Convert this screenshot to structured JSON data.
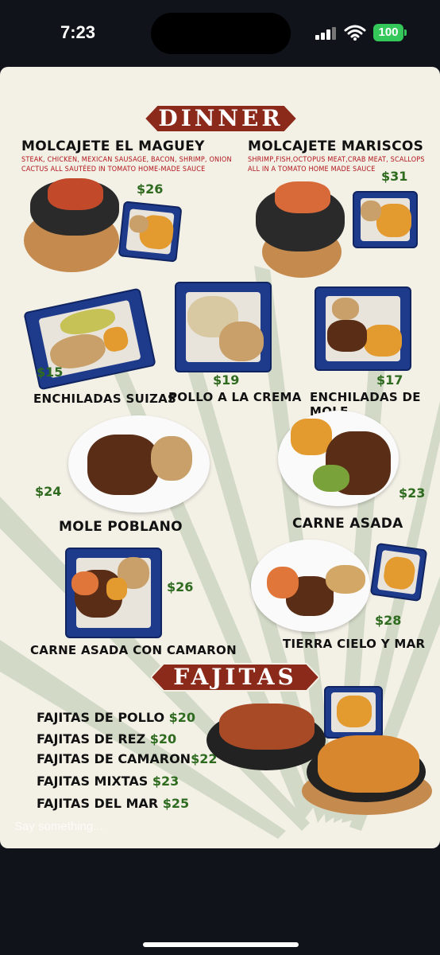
{
  "status_bar": {
    "time": "7:23",
    "battery": "100"
  },
  "menu": {
    "dinner_banner": "DINNER",
    "fajitas_banner": "FAJITAS",
    "dishes": [
      {
        "name": "MOLCAJETE EL MAGUEY",
        "desc_1": "STEAK, CHICKEN, MEXICAN SAUSAGE, BACON, SHRIMP, ONION",
        "desc_2": "CACTUS ALL SAUTÉED IN TOMATO HOME-MADE SAUCE",
        "price": "$26"
      },
      {
        "name": "MOLCAJETE MARISCOS",
        "desc_1": "SHRIMP,FISH,OCTOPUS MEAT,CRAB MEAT, SCALLOPS",
        "desc_2": "ALL IN A TOMATO HOME MADE SAUCE",
        "price": "$31"
      },
      {
        "name": "ENCHILADAS SUIZAS",
        "price": "$15"
      },
      {
        "name": "POLLO A LA CREMA",
        "price": "$19"
      },
      {
        "name": "ENCHILADAS DE MOLE",
        "price": "$17"
      },
      {
        "name": "MOLE POBLANO",
        "price": "$24"
      },
      {
        "name": "CARNE ASADA",
        "price": "$23"
      },
      {
        "name": "CARNE ASADA CON CAMARON",
        "price": "$26"
      },
      {
        "name": "TIERRA CIELO Y MAR",
        "price": "$28"
      }
    ],
    "fajitas": [
      {
        "name": "FAJITAS DE POLLO",
        "price": "$20"
      },
      {
        "name": "FAJITAS DE REZ",
        "price": "$20"
      },
      {
        "name": "FAJITAS DE CAMARON",
        "price": "$22"
      },
      {
        "name": "FAJITAS MIXTAS",
        "price": "$23"
      },
      {
        "name": "FAJITAS DEL MAR",
        "price": "$25"
      }
    ]
  },
  "chat": {
    "placeholder": "Say something..."
  },
  "colors": {
    "banner": "#8b2a1a",
    "price": "#2e6b1f",
    "desc": "#b0141a",
    "plate_blue": "#1e3a8a"
  }
}
